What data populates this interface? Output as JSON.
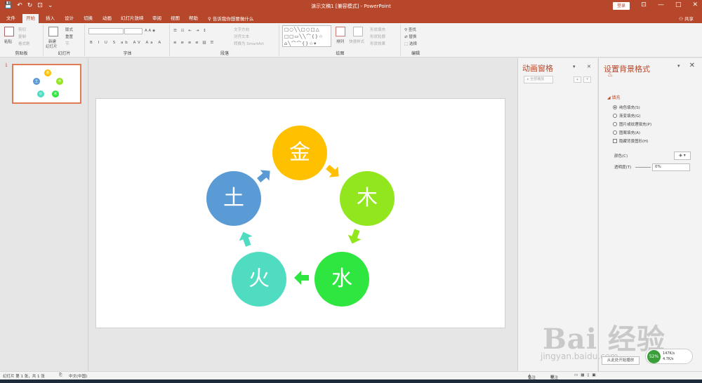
{
  "titlebar": {
    "title": "演示文稿1 [兼容模式] - PowerPoint",
    "login": "登录",
    "quick_access": [
      "💾",
      "↶",
      "↻",
      "⊡",
      "⌄"
    ],
    "window_controls": [
      "⊡",
      "—",
      "□",
      "✕"
    ]
  },
  "tabs": {
    "items": [
      "文件",
      "开始",
      "插入",
      "设计",
      "切换",
      "动画",
      "幻灯片放映",
      "审阅",
      "视图",
      "帮助"
    ],
    "active": "开始",
    "tell_me": "告诉我你想要做什么",
    "share": "共享"
  },
  "ribbon": {
    "clipboard": {
      "label": "剪贴板",
      "paste": "粘贴",
      "cut": "剪切",
      "copy": "复制",
      "format_painter": "格式刷"
    },
    "slides": {
      "label": "幻灯片",
      "new_slide": "新建",
      "new_slide2": "幻灯片",
      "layout": "版式",
      "reset": "重置",
      "section": "节"
    },
    "font": {
      "label": "字体",
      "font_name": "",
      "font_size": "",
      "buttons": [
        "B",
        "I",
        "U",
        "S",
        "ab",
        "AV",
        "Aa",
        "A"
      ]
    },
    "paragraph": {
      "label": "段落",
      "text_direction": "文字方向",
      "align_text": "对齐文本",
      "smartart": "转换为 SmartArt"
    },
    "drawing": {
      "label": "绘图",
      "shapes_preview": "□○╲╲□○□△\n□□▭╲╲⌒{}☆\n⌂╲⌒⌒{}☆▾",
      "arrange": "排列",
      "quick_styles": "快速样式",
      "shape_fill": "形状填充",
      "shape_outline": "形状轮廓",
      "shape_effects": "形状效果"
    },
    "editing": {
      "label": "编辑",
      "find": "查找",
      "replace": "替换",
      "select": "选择"
    }
  },
  "thumbnails": {
    "slide_number": "1"
  },
  "slide": {
    "elements": [
      {
        "char": "金",
        "color": "#FFC000"
      },
      {
        "char": "木",
        "color": "#92E61E"
      },
      {
        "char": "水",
        "color": "#2FE640"
      },
      {
        "char": "火",
        "color": "#4FDCC0"
      },
      {
        "char": "土",
        "color": "#5B9BD5"
      }
    ],
    "arrow_colors": [
      "#FFC000",
      "#92E61E",
      "#2FE640",
      "#4FDCC0",
      "#5B9BD5"
    ]
  },
  "animation_pane": {
    "title": "动画窗格",
    "play_all": "全部播放",
    "play_from": "从此处开始播放",
    "up": "▴",
    "down": "▾",
    "dropdown": "▾",
    "close": "✕"
  },
  "format_pane": {
    "title": "设置背景格式",
    "section": "◢ 填充",
    "options": [
      {
        "label": "纯色填充(S)",
        "selected": true
      },
      {
        "label": "渐变填充(G)",
        "selected": false
      },
      {
        "label": "图片或纹理填充(P)",
        "selected": false
      },
      {
        "label": "图案填充(A)",
        "selected": false
      }
    ],
    "hide_bg": "隐藏背景图形(H)",
    "color_label": "颜色(C)",
    "color_btn": "◈ ▾",
    "transparency_label": "透明度(T)",
    "transparency_value": "0%",
    "close": "✕"
  },
  "statusbar": {
    "slide_info": "幻灯片 第 1 张，共 1 张",
    "language": "中文(中国)",
    "notes": "备注",
    "comments": "批注"
  },
  "watermark": {
    "brand": "Bai 经验",
    "sub": "jingyan.baidu.com"
  },
  "network_widget": {
    "percent": "52%",
    "up": "147K/s",
    "down": "4.7K/s"
  }
}
